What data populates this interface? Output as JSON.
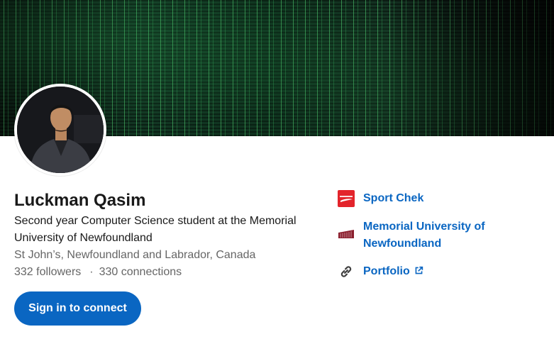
{
  "profile": {
    "name": "Luckman Qasim",
    "headline": "Second year Computer Science student at the Memorial University of Newfoundland",
    "location": "St John’s, Newfoundland and Labrador, Canada",
    "followers": "332 followers",
    "separator": "·",
    "connections": "330 connections",
    "connect_button": "Sign in to connect"
  },
  "sidebar": {
    "items": [
      {
        "label": "Sport Chek",
        "icon": "sport-chek-logo"
      },
      {
        "label": "Memorial University of Newfoundland",
        "icon": "memorial-university-logo"
      },
      {
        "label": "Portfolio",
        "icon": "link-icon",
        "external": "external-link-icon"
      }
    ]
  },
  "colors": {
    "accent": "#0a66c2",
    "text_secondary": "#666666",
    "sport_chek_red": "#e3242b",
    "memorial_maroon": "#8b1e2d"
  }
}
